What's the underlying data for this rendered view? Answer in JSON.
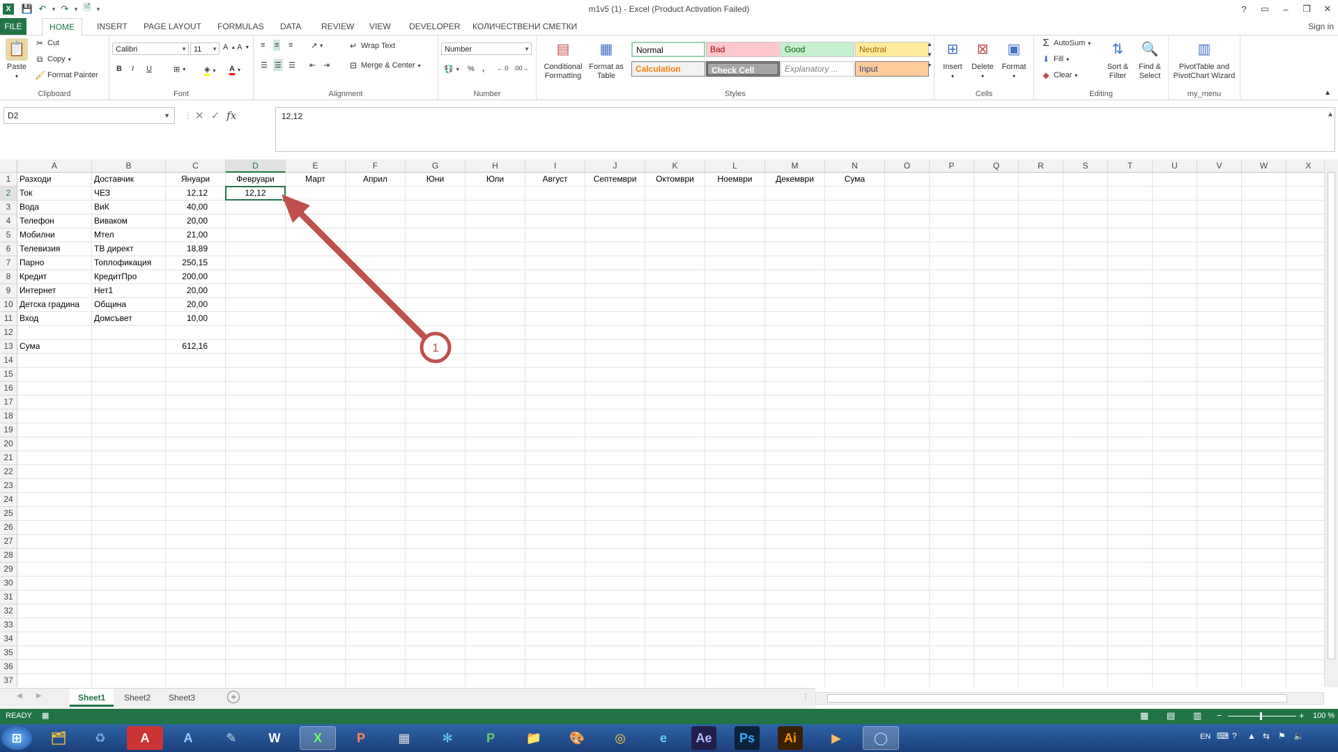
{
  "window": {
    "title": "m1v5 (1) - Excel (Product Activation Failed)",
    "help": "?",
    "minimize": "–",
    "restore": "❐",
    "close": "✕"
  },
  "qat": {
    "save": "💾",
    "undo": "↶",
    "redo": "↷",
    "preview": "🗎",
    "more": "▾"
  },
  "tabs": [
    "FILE",
    "HOME",
    "INSERT",
    "PAGE LAYOUT",
    "FORMULAS",
    "DATA",
    "REVIEW",
    "VIEW",
    "DEVELOPER",
    "КОЛИЧЕСТВЕНИ СМЕТКИ"
  ],
  "active_tab": "HOME",
  "signin": "Sign in",
  "ribbon": {
    "clipboard": {
      "label": "Clipboard",
      "paste": "Paste",
      "cut": "Cut",
      "copy": "Copy",
      "format_painter": "Format Painter"
    },
    "font": {
      "label": "Font",
      "name": "Calibri",
      "size": "11",
      "bold": "B",
      "italic": "I",
      "underline": "U"
    },
    "alignment": {
      "label": "Alignment",
      "wrap_text": "Wrap Text",
      "merge_center": "Merge & Center"
    },
    "number": {
      "label": "Number",
      "format": "Number",
      "percent": "%",
      "comma": ","
    },
    "styles": {
      "label": "Styles",
      "conditional_formatting": "Conditional Formatting",
      "format_as_table": "Format as Table",
      "normal": "Normal",
      "bad": "Bad",
      "good": "Good",
      "neutral": "Neutral",
      "calculation": "Calculation",
      "check_cell": "Check Cell",
      "explanatory": "Explanatory ...",
      "input": "Input"
    },
    "cells": {
      "label": "Cells",
      "insert": "Insert",
      "delete": "Delete",
      "format": "Format"
    },
    "editing": {
      "label": "Editing",
      "autosum": "AutoSum",
      "fill": "Fill",
      "clear": "Clear",
      "sort_filter": "Sort & Filter",
      "find_select": "Find & Select"
    },
    "my_menu": {
      "label": "my_menu",
      "pivot": "PivotTable and PivotChart Wizard"
    }
  },
  "formula_bar": {
    "name_box": "D2",
    "value": "12,12",
    "fx": "fx",
    "cancel": "✕",
    "enter": "✓"
  },
  "columns": [
    "A",
    "B",
    "C",
    "D",
    "E",
    "F",
    "G",
    "H",
    "I",
    "J",
    "K",
    "L",
    "M",
    "N",
    "O",
    "P",
    "Q",
    "R",
    "S",
    "T",
    "U",
    "V",
    "W",
    "X"
  ],
  "selected_column": "D",
  "selected_row": 2,
  "row_count": 37,
  "cells": {
    "r1": [
      "Разходи",
      "Доставчик",
      "Януари",
      "Февруари",
      "Март",
      "Април",
      "Юни",
      "Юли",
      "Август",
      "Септември",
      "Октомври",
      "Ноември",
      "Декември",
      "Сума"
    ],
    "rows": [
      {
        "row": 2,
        "a": "Ток",
        "b": "ЧЕЗ",
        "c": "12,12",
        "d": "12,12"
      },
      {
        "row": 3,
        "a": "Вода",
        "b": "ВиК",
        "c": "40,00"
      },
      {
        "row": 4,
        "a": "Телефон",
        "b": "Виваком",
        "c": "20,00"
      },
      {
        "row": 5,
        "a": "Мобилни",
        "b": "Мтел",
        "c": "21,00"
      },
      {
        "row": 6,
        "a": "Телевизия",
        "b": "ТВ директ",
        "c": "18,89"
      },
      {
        "row": 7,
        "a": "Парно",
        "b": "Топлофикация",
        "c": "250,15"
      },
      {
        "row": 8,
        "a": "Кредит",
        "b": "КредитПро",
        "c": "200,00"
      },
      {
        "row": 9,
        "a": "Интернет",
        "b": "Нет1",
        "c": "20,00"
      },
      {
        "row": 10,
        "a": "Детска градина",
        "b": "Община",
        "c": "20,00"
      },
      {
        "row": 11,
        "a": "Вход",
        "b": "Домсъвет",
        "c": "10,00"
      },
      {
        "row": 13,
        "a": "Сума",
        "b": "",
        "c": "612,16"
      }
    ]
  },
  "sheets": [
    "Sheet1",
    "Sheet2",
    "Sheet3"
  ],
  "active_sheet": "Sheet1",
  "status": {
    "mode": "READY",
    "zoom": "100 %"
  },
  "annotation": {
    "label": "1",
    "color": "#c0504d"
  },
  "taskbar": {
    "lang": "EN",
    "apps": [
      "start",
      "explorer",
      "recycle",
      "autocad",
      "civil",
      "notepad",
      "word",
      "excel",
      "powerpoint",
      "calculator",
      "network",
      "project",
      "folder",
      "paint",
      "chrome",
      "ie",
      "after-effects",
      "photoshop",
      "illustrator",
      "media",
      "skype"
    ]
  }
}
